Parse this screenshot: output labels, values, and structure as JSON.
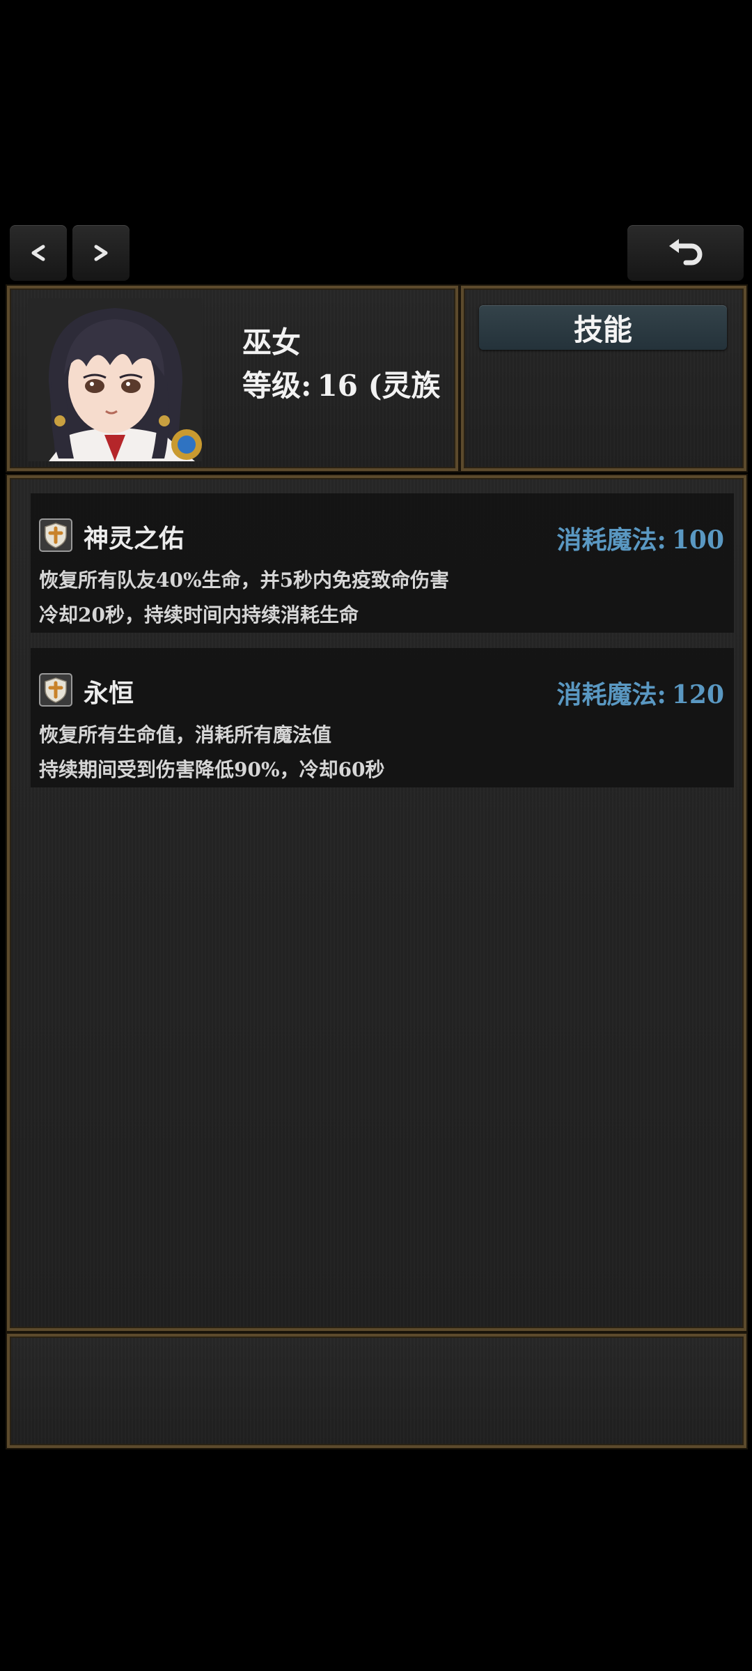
{
  "nav": {
    "prev_label": "<",
    "next_label": ">",
    "back_icon": "undo-arrow-icon"
  },
  "character": {
    "name": "巫女",
    "level_label": "等级:",
    "level_value": "16 (灵族",
    "portrait": "shrine-maiden-portrait"
  },
  "tabs": {
    "skills_label": "技能"
  },
  "skills": [
    {
      "icon": "shield-cross-icon",
      "name": "神灵之佑",
      "cost_label": "消耗魔法:",
      "cost_value": "100",
      "desc_line1": "恢复所有队友40%生命，并5秒内免疫致命伤害",
      "desc_line2": "冷却20秒，持续时间内持续消耗生命"
    },
    {
      "icon": "shield-cross-icon",
      "name": "永恒",
      "cost_label": "消耗魔法:",
      "cost_value": "120",
      "desc_line1": "恢复所有生命值，消耗所有魔法值",
      "desc_line2": "持续期间受到伤害降低90%，冷却60秒"
    }
  ],
  "colors": {
    "panel_border": "#5c4a2c",
    "cost_blue": "#5a98c2",
    "tab_button": "#2c3b43"
  }
}
